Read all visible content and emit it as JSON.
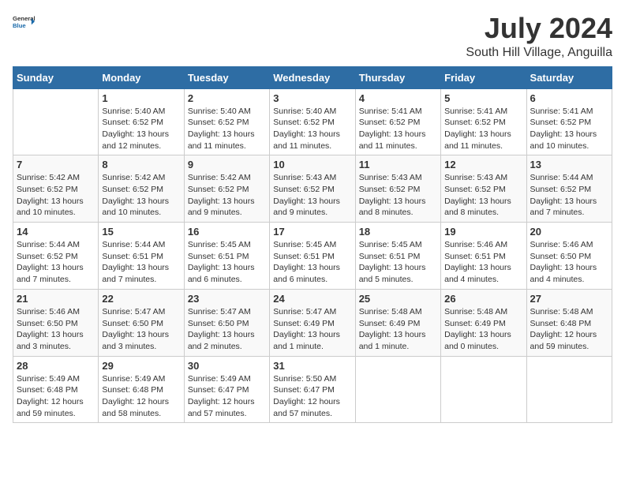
{
  "header": {
    "logo_general": "General",
    "logo_blue": "Blue",
    "month": "July 2024",
    "location": "South Hill Village, Anguilla"
  },
  "days_of_week": [
    "Sunday",
    "Monday",
    "Tuesday",
    "Wednesday",
    "Thursday",
    "Friday",
    "Saturday"
  ],
  "weeks": [
    [
      {
        "day": "",
        "info": ""
      },
      {
        "day": "1",
        "info": "Sunrise: 5:40 AM\nSunset: 6:52 PM\nDaylight: 13 hours\nand 12 minutes."
      },
      {
        "day": "2",
        "info": "Sunrise: 5:40 AM\nSunset: 6:52 PM\nDaylight: 13 hours\nand 11 minutes."
      },
      {
        "day": "3",
        "info": "Sunrise: 5:40 AM\nSunset: 6:52 PM\nDaylight: 13 hours\nand 11 minutes."
      },
      {
        "day": "4",
        "info": "Sunrise: 5:41 AM\nSunset: 6:52 PM\nDaylight: 13 hours\nand 11 minutes."
      },
      {
        "day": "5",
        "info": "Sunrise: 5:41 AM\nSunset: 6:52 PM\nDaylight: 13 hours\nand 11 minutes."
      },
      {
        "day": "6",
        "info": "Sunrise: 5:41 AM\nSunset: 6:52 PM\nDaylight: 13 hours\nand 10 minutes."
      }
    ],
    [
      {
        "day": "7",
        "info": "Sunrise: 5:42 AM\nSunset: 6:52 PM\nDaylight: 13 hours\nand 10 minutes."
      },
      {
        "day": "8",
        "info": "Sunrise: 5:42 AM\nSunset: 6:52 PM\nDaylight: 13 hours\nand 10 minutes."
      },
      {
        "day": "9",
        "info": "Sunrise: 5:42 AM\nSunset: 6:52 PM\nDaylight: 13 hours\nand 9 minutes."
      },
      {
        "day": "10",
        "info": "Sunrise: 5:43 AM\nSunset: 6:52 PM\nDaylight: 13 hours\nand 9 minutes."
      },
      {
        "day": "11",
        "info": "Sunrise: 5:43 AM\nSunset: 6:52 PM\nDaylight: 13 hours\nand 8 minutes."
      },
      {
        "day": "12",
        "info": "Sunrise: 5:43 AM\nSunset: 6:52 PM\nDaylight: 13 hours\nand 8 minutes."
      },
      {
        "day": "13",
        "info": "Sunrise: 5:44 AM\nSunset: 6:52 PM\nDaylight: 13 hours\nand 7 minutes."
      }
    ],
    [
      {
        "day": "14",
        "info": "Sunrise: 5:44 AM\nSunset: 6:52 PM\nDaylight: 13 hours\nand 7 minutes."
      },
      {
        "day": "15",
        "info": "Sunrise: 5:44 AM\nSunset: 6:51 PM\nDaylight: 13 hours\nand 7 minutes."
      },
      {
        "day": "16",
        "info": "Sunrise: 5:45 AM\nSunset: 6:51 PM\nDaylight: 13 hours\nand 6 minutes."
      },
      {
        "day": "17",
        "info": "Sunrise: 5:45 AM\nSunset: 6:51 PM\nDaylight: 13 hours\nand 6 minutes."
      },
      {
        "day": "18",
        "info": "Sunrise: 5:45 AM\nSunset: 6:51 PM\nDaylight: 13 hours\nand 5 minutes."
      },
      {
        "day": "19",
        "info": "Sunrise: 5:46 AM\nSunset: 6:51 PM\nDaylight: 13 hours\nand 4 minutes."
      },
      {
        "day": "20",
        "info": "Sunrise: 5:46 AM\nSunset: 6:50 PM\nDaylight: 13 hours\nand 4 minutes."
      }
    ],
    [
      {
        "day": "21",
        "info": "Sunrise: 5:46 AM\nSunset: 6:50 PM\nDaylight: 13 hours\nand 3 minutes."
      },
      {
        "day": "22",
        "info": "Sunrise: 5:47 AM\nSunset: 6:50 PM\nDaylight: 13 hours\nand 3 minutes."
      },
      {
        "day": "23",
        "info": "Sunrise: 5:47 AM\nSunset: 6:50 PM\nDaylight: 13 hours\nand 2 minutes."
      },
      {
        "day": "24",
        "info": "Sunrise: 5:47 AM\nSunset: 6:49 PM\nDaylight: 13 hours\nand 1 minute."
      },
      {
        "day": "25",
        "info": "Sunrise: 5:48 AM\nSunset: 6:49 PM\nDaylight: 13 hours\nand 1 minute."
      },
      {
        "day": "26",
        "info": "Sunrise: 5:48 AM\nSunset: 6:49 PM\nDaylight: 13 hours\nand 0 minutes."
      },
      {
        "day": "27",
        "info": "Sunrise: 5:48 AM\nSunset: 6:48 PM\nDaylight: 12 hours\nand 59 minutes."
      }
    ],
    [
      {
        "day": "28",
        "info": "Sunrise: 5:49 AM\nSunset: 6:48 PM\nDaylight: 12 hours\nand 59 minutes."
      },
      {
        "day": "29",
        "info": "Sunrise: 5:49 AM\nSunset: 6:48 PM\nDaylight: 12 hours\nand 58 minutes."
      },
      {
        "day": "30",
        "info": "Sunrise: 5:49 AM\nSunset: 6:47 PM\nDaylight: 12 hours\nand 57 minutes."
      },
      {
        "day": "31",
        "info": "Sunrise: 5:50 AM\nSunset: 6:47 PM\nDaylight: 12 hours\nand 57 minutes."
      },
      {
        "day": "",
        "info": ""
      },
      {
        "day": "",
        "info": ""
      },
      {
        "day": "",
        "info": ""
      }
    ]
  ]
}
